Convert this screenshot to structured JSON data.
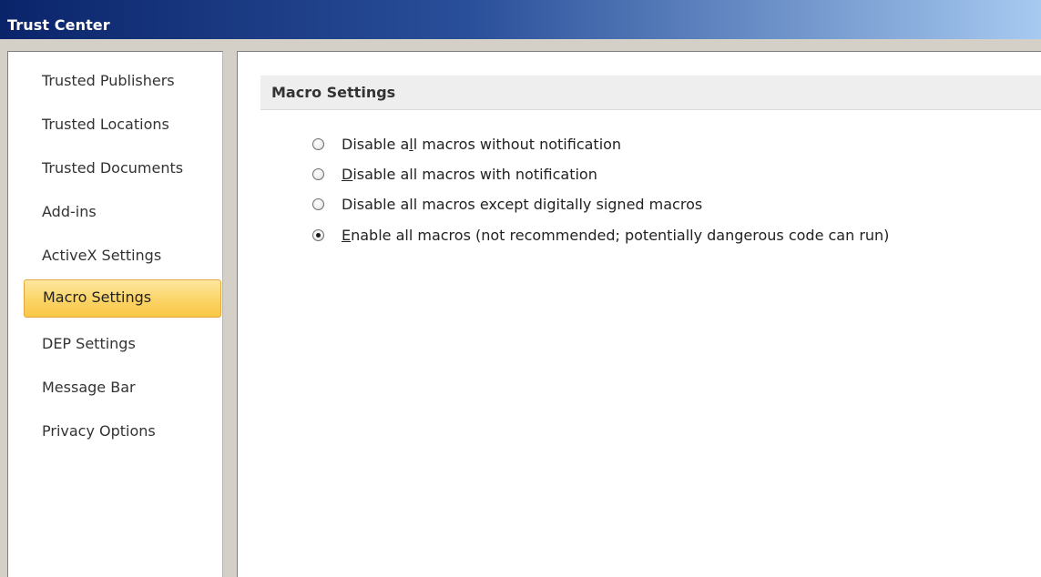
{
  "window": {
    "title": "Trust Center"
  },
  "sidebar": {
    "items": [
      {
        "label": "Trusted Publishers",
        "selected": false
      },
      {
        "label": "Trusted Locations",
        "selected": false
      },
      {
        "label": "Trusted Documents",
        "selected": false
      },
      {
        "label": "Add-ins",
        "selected": false
      },
      {
        "label": "ActiveX Settings",
        "selected": false
      },
      {
        "label": "Macro Settings",
        "selected": true
      },
      {
        "label": "DEP Settings",
        "selected": false
      },
      {
        "label": "Message Bar",
        "selected": false
      },
      {
        "label": "Privacy Options",
        "selected": false
      }
    ]
  },
  "main": {
    "section_title": "Macro Settings",
    "options": [
      {
        "before": "Disable a",
        "underline": "l",
        "after": "l macros without notification",
        "checked": false
      },
      {
        "before": "",
        "underline": "D",
        "after": "isable all macros with notification",
        "checked": false
      },
      {
        "before": "Disable all macros except di",
        "underline": "g",
        "after": "itally signed macros",
        "checked": false
      },
      {
        "before": "",
        "underline": "E",
        "after": "nable all macros (not recommended; potentially dangerous code can run)",
        "checked": true
      }
    ]
  },
  "colors": {
    "title_bar_start": "#0a246a",
    "title_bar_end": "#a6caf0",
    "selected_item_fill": "#fbd466",
    "selected_item_border": "#e3a73b",
    "section_header_bg": "#eeeeee"
  }
}
